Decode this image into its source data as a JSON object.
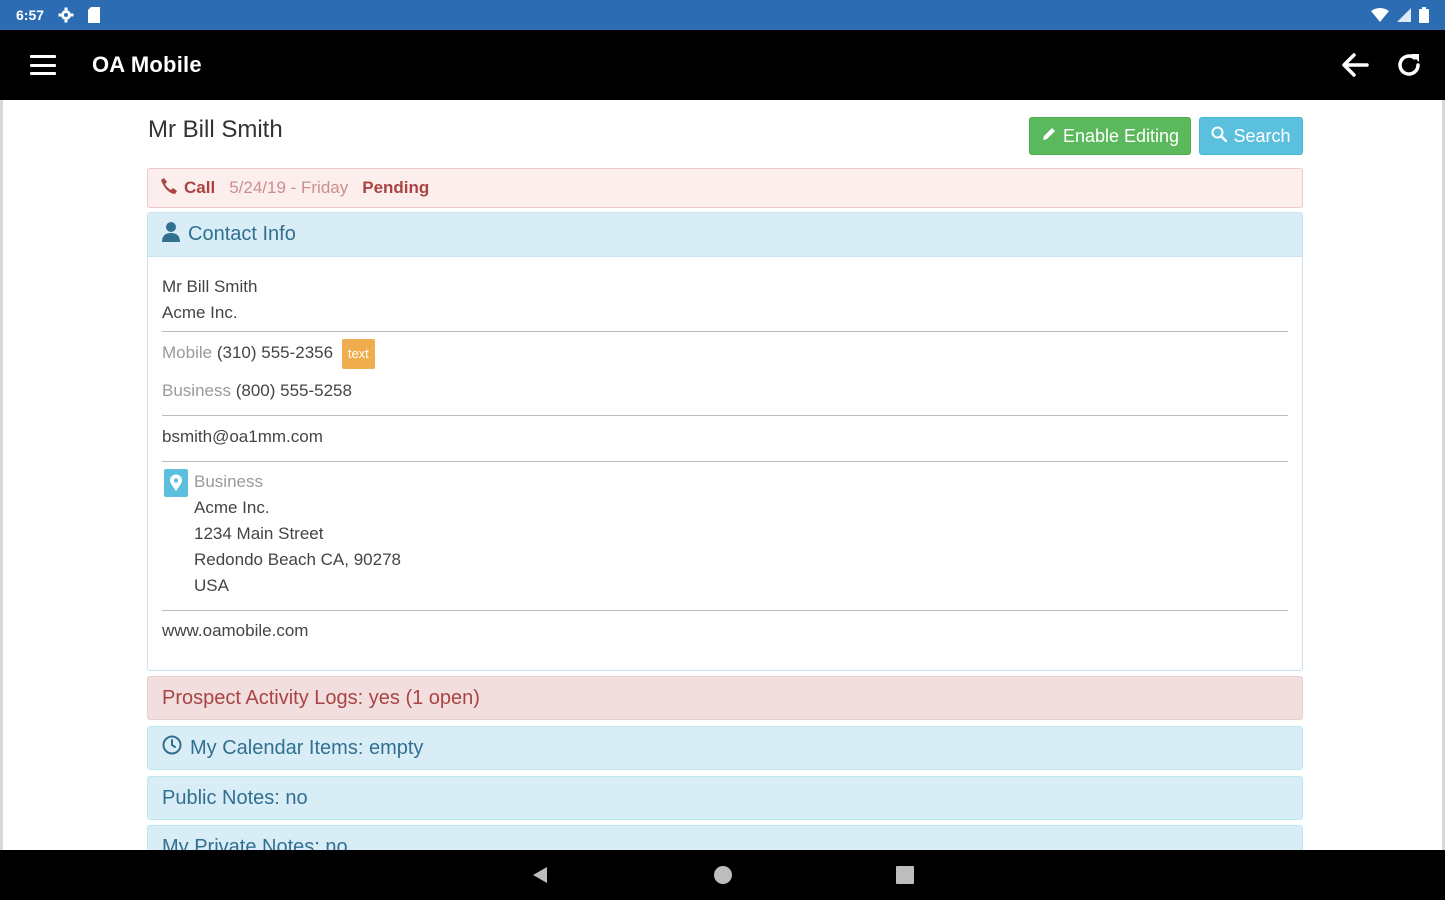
{
  "status_bar": {
    "time": "6:57"
  },
  "app_bar": {
    "title": "OA Mobile"
  },
  "header": {
    "name": "Mr Bill Smith",
    "enable_editing_label": "Enable Editing",
    "search_label": "Search"
  },
  "call_alert": {
    "label": "Call",
    "date": "5/24/19 - Friday",
    "status": "Pending"
  },
  "contact_info": {
    "heading": "Contact Info",
    "name": "Mr Bill Smith",
    "company": "Acme Inc.",
    "mobile_label": "Mobile",
    "mobile_number": "(310) 555-2356",
    "text_button": "text",
    "business_label": "Business",
    "business_number": "(800) 555-5258",
    "email": "bsmith@oa1mm.com",
    "address_type": "Business",
    "address_company": "Acme Inc.",
    "address_street": "1234 Main Street",
    "address_city": "Redondo Beach CA, 90278",
    "address_country": "USA",
    "website": "www.oamobile.com"
  },
  "sections": {
    "activity_logs": "Prospect Activity Logs: yes (1 open)",
    "calendar_items": "My Calendar Items: empty",
    "public_notes": "Public Notes: no",
    "private_notes": "My Private Notes: no"
  },
  "colors": {
    "status_bar": "#2b6cb3",
    "success": "#5cb85c",
    "info": "#5bc0de",
    "warning": "#f0ad4e",
    "danger_text": "#a94442",
    "info_text": "#31708f"
  }
}
